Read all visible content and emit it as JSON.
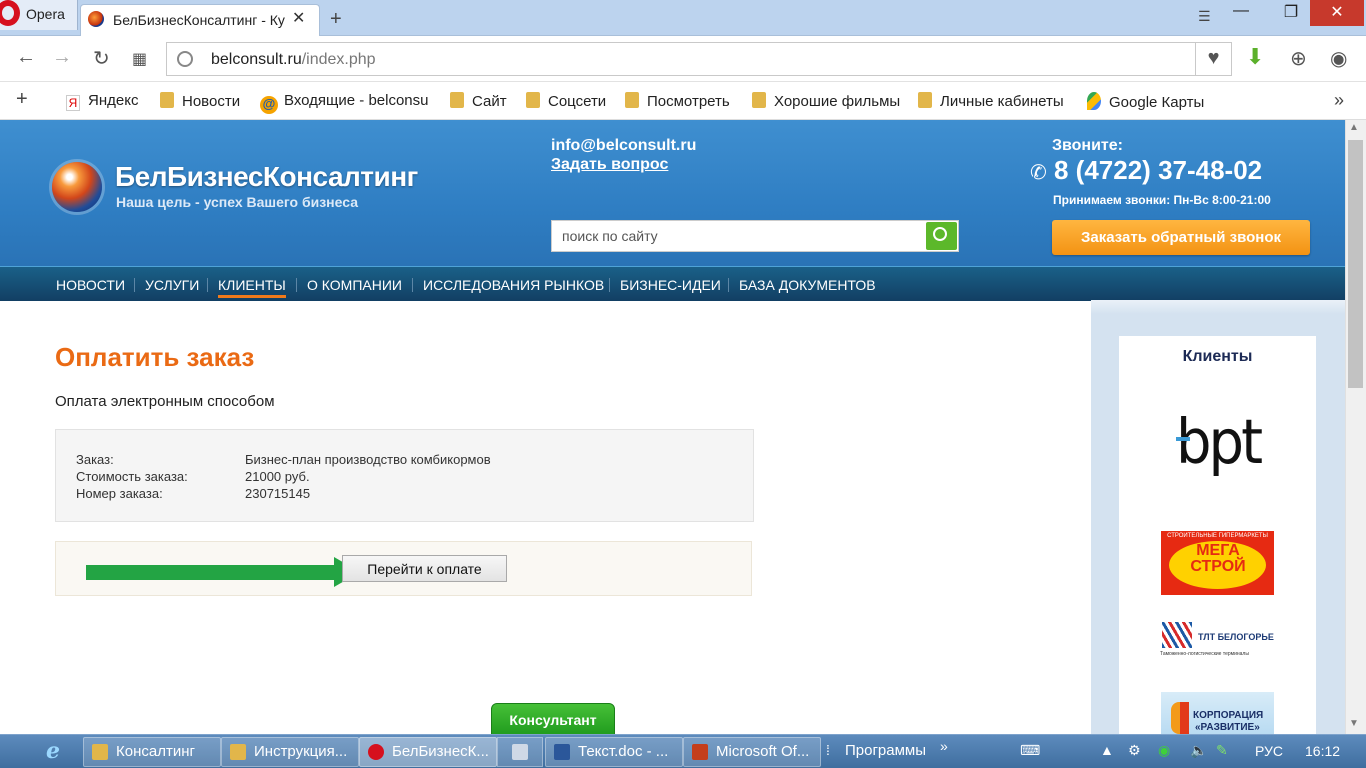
{
  "browser": {
    "menu_label": "Opera",
    "tab_title": "БелБизнесКонсалтинг - Ку",
    "url_host": "belconsult.ru",
    "url_path": "/index.php",
    "bookmarks": [
      "Яндекс",
      "Новости",
      "Входящие - belconsu",
      "Сайт",
      "Соцсети",
      "Посмотреть",
      "Хорошие фильмы",
      "Личные кабинеты",
      "Google Карты"
    ]
  },
  "site": {
    "brand": "БелБизнесКонсалтинг",
    "slogan": "Наша цель - успех Вашего бизнеса",
    "email": "info@belconsult.ru",
    "ask_question": "Задать вопрос",
    "search_placeholder": "поиск по сайту",
    "call_label": "Звоните:",
    "phone": "8 (4722) 37-48-02",
    "hours": "Принимаем звонки: Пн-Вс 8:00-21:00",
    "callback_button": "Заказать обратный звонок",
    "menu": [
      "НОВОСТИ",
      "УСЛУГИ",
      "КЛИЕНТЫ",
      "О КОМПАНИИ",
      "ИССЛЕДОВАНИЯ РЫНКОВ",
      "БИЗНЕС-ИДЕИ",
      "БАЗА ДОКУМЕНТОВ"
    ],
    "active_menu": "КЛИЕНТЫ"
  },
  "content": {
    "title": "Оплатить заказ",
    "subtitle": "Оплата электронным способом",
    "order": {
      "label_order": "Заказ:",
      "value_order": "Бизнес-план производство комбикормов",
      "label_cost": "Стоимость заказа:",
      "value_cost": "21000 руб.",
      "label_number": "Номер заказа:",
      "value_number": "230715145"
    },
    "pay_button": "Перейти к оплате"
  },
  "sidebar": {
    "title": "Клиенты",
    "logos": {
      "bpt": "bpt",
      "megastroy_small": "СТРОИТЕЛЬНЫЕ ГИПЕРМАРКЕТЫ",
      "megastroy_name": "МЕГА СТРОЙ",
      "tlt_name": "ТЛТ БЕЛОГОРЬЕ",
      "tlt_sub": "Таможенно-логистические терминалы",
      "razvitie_1": "КОРПОРАЦИЯ",
      "razvitie_2": "«РАЗВИТИЕ»"
    }
  },
  "consultant_button": "Консультант",
  "taskbar": {
    "items": [
      "Консалтинг",
      "Инструкция...",
      "БелБизнесК...",
      "Текст.doc - ...",
      "Microsoft Of..."
    ],
    "programs": "Программы",
    "language": "РУС",
    "time": "16:12"
  },
  "colors": {
    "header_blue": "#3f8fd0",
    "accent_orange": "#ea6a14",
    "callback_orange": "#f39313",
    "green": "#23a444"
  }
}
